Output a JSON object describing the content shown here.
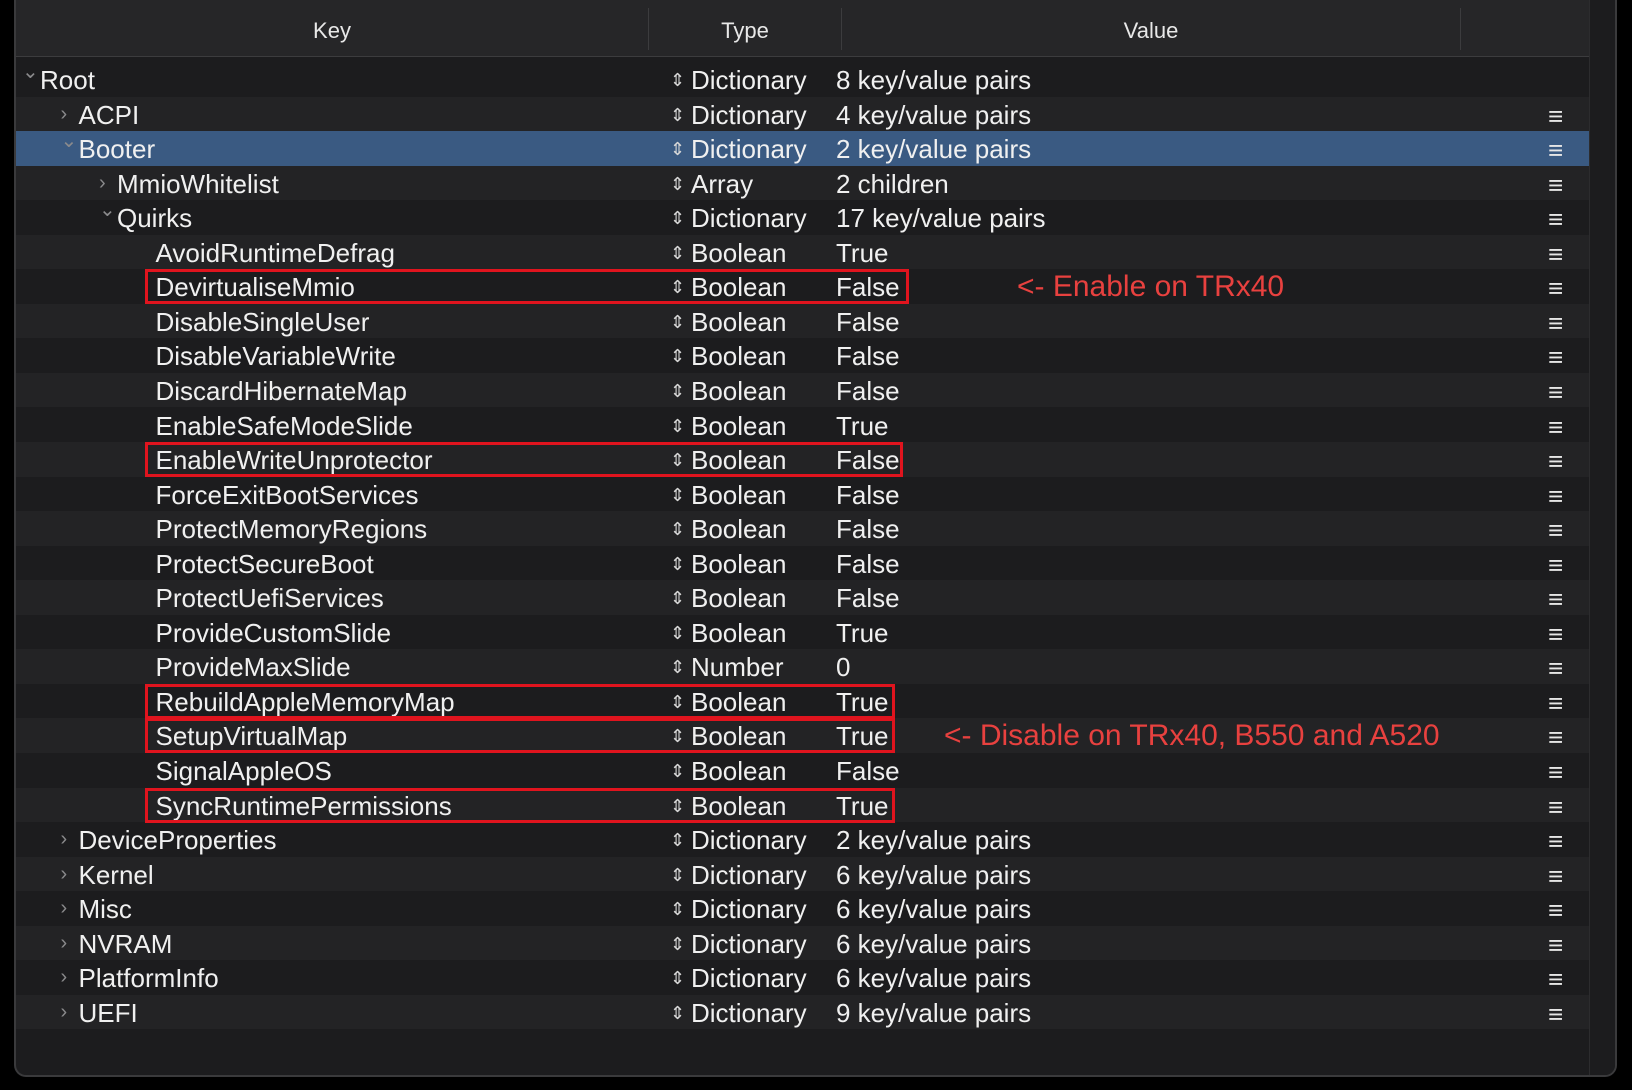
{
  "columns": {
    "key": "Key",
    "type": "Type",
    "value": "Value"
  },
  "stepper_glyph": "⇕",
  "menu_glyph": "≡",
  "rows": [
    {
      "key": "Root",
      "type": "Dictionary",
      "value": "8 key/value pairs",
      "depth": 0,
      "expanded": true,
      "menu": false
    },
    {
      "key": "ACPI",
      "type": "Dictionary",
      "value": "4 key/value pairs",
      "depth": 1,
      "expanded": false
    },
    {
      "key": "Booter",
      "type": "Dictionary",
      "value": "2 key/value pairs",
      "depth": 1,
      "expanded": true,
      "selected": true
    },
    {
      "key": "MmioWhitelist",
      "type": "Array",
      "value": "2 children",
      "depth": 2,
      "expanded": false
    },
    {
      "key": "Quirks",
      "type": "Dictionary",
      "value": "17 key/value pairs",
      "depth": 2,
      "expanded": true
    },
    {
      "key": "AvoidRuntimeDefrag",
      "type": "Boolean",
      "value": "True",
      "depth": 3
    },
    {
      "key": "DevirtualiseMmio",
      "type": "Boolean",
      "value": "False",
      "depth": 3,
      "highlighted": true
    },
    {
      "key": "DisableSingleUser",
      "type": "Boolean",
      "value": "False",
      "depth": 3
    },
    {
      "key": "DisableVariableWrite",
      "type": "Boolean",
      "value": "False",
      "depth": 3
    },
    {
      "key": "DiscardHibernateMap",
      "type": "Boolean",
      "value": "False",
      "depth": 3
    },
    {
      "key": "EnableSafeModeSlide",
      "type": "Boolean",
      "value": "True",
      "depth": 3
    },
    {
      "key": "EnableWriteUnprotector",
      "type": "Boolean",
      "value": "False",
      "depth": 3,
      "highlighted": true
    },
    {
      "key": "ForceExitBootServices",
      "type": "Boolean",
      "value": "False",
      "depth": 3
    },
    {
      "key": "ProtectMemoryRegions",
      "type": "Boolean",
      "value": "False",
      "depth": 3
    },
    {
      "key": "ProtectSecureBoot",
      "type": "Boolean",
      "value": "False",
      "depth": 3
    },
    {
      "key": "ProtectUefiServices",
      "type": "Boolean",
      "value": "False",
      "depth": 3
    },
    {
      "key": "ProvideCustomSlide",
      "type": "Boolean",
      "value": "True",
      "depth": 3
    },
    {
      "key": "ProvideMaxSlide",
      "type": "Number",
      "value": "0",
      "depth": 3
    },
    {
      "key": "RebuildAppleMemoryMap",
      "type": "Boolean",
      "value": "True",
      "depth": 3,
      "highlighted": true
    },
    {
      "key": "SetupVirtualMap",
      "type": "Boolean",
      "value": "True",
      "depth": 3,
      "highlighted": true
    },
    {
      "key": "SignalAppleOS",
      "type": "Boolean",
      "value": "False",
      "depth": 3
    },
    {
      "key": "SyncRuntimePermissions",
      "type": "Boolean",
      "value": "True",
      "depth": 3,
      "highlighted": true
    },
    {
      "key": "DeviceProperties",
      "type": "Dictionary",
      "value": "2 key/value pairs",
      "depth": 1,
      "expanded": false
    },
    {
      "key": "Kernel",
      "type": "Dictionary",
      "value": "6 key/value pairs",
      "depth": 1,
      "expanded": false
    },
    {
      "key": "Misc",
      "type": "Dictionary",
      "value": "6 key/value pairs",
      "depth": 1,
      "expanded": false
    },
    {
      "key": "NVRAM",
      "type": "Dictionary",
      "value": "6 key/value pairs",
      "depth": 1,
      "expanded": false
    },
    {
      "key": "PlatformInfo",
      "type": "Dictionary",
      "value": "6 key/value pairs",
      "depth": 1,
      "expanded": false
    },
    {
      "key": "UEFI",
      "type": "Dictionary",
      "value": "9 key/value pairs",
      "depth": 1,
      "expanded": false
    }
  ],
  "annotations": [
    {
      "text": "<- Enable on TRx40",
      "row": 6
    },
    {
      "text": "<- Disable on TRx40, B550 and A520",
      "row": 19
    }
  ],
  "colors": {
    "highlight": "#e0141e",
    "annotation": "#e8413f",
    "selection": "#3a5a82"
  }
}
